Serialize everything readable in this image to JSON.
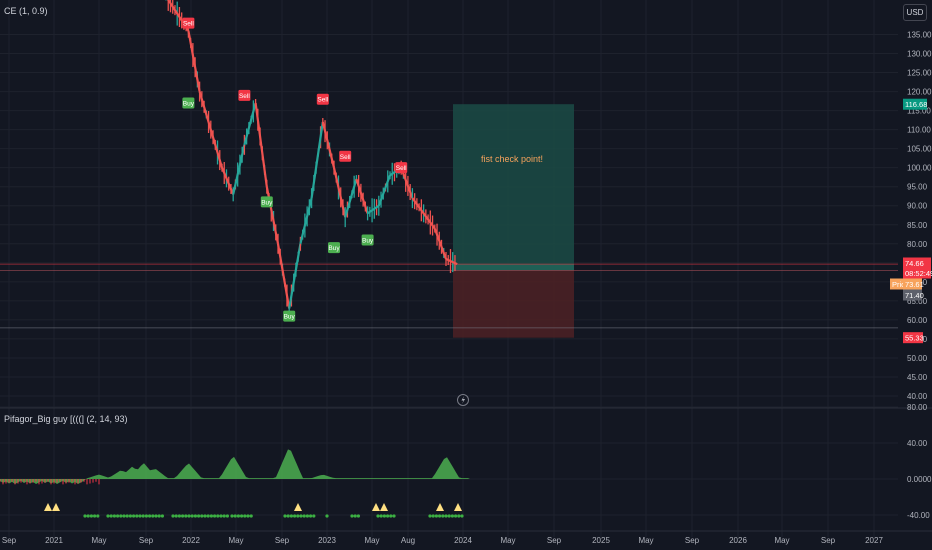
{
  "symbol_legend": "CE (1, 0.9)",
  "indicator_legend": "Pifagor_Big guy [(((] (2, 14, 93)",
  "currency": "USD",
  "annotation": "fist check point!",
  "colors": {
    "background": "#131722",
    "up": "#26a69a",
    "down": "#ef5350",
    "buy": "#4caf50",
    "sell": "#f23645",
    "target_zone": "#1b4b45",
    "stop_zone": "#4a2025",
    "annotation": "#f7a35c"
  },
  "chart_data": [
    {
      "type": "line",
      "title": "",
      "y_axis_ticks": [
        "40.00",
        "45.00",
        "50.00",
        "55.00",
        "60.00",
        "65.00",
        "70.00",
        "75.00",
        "80.00",
        "85.00",
        "90.00",
        "95.00",
        "100.00",
        "105.00",
        "110.00",
        "115.00",
        "120.00",
        "125.00",
        "130.00",
        "135.00"
      ],
      "ylim": [
        38,
        145
      ],
      "x_axis_ticks": [
        "Sep",
        "2021",
        "May",
        "Sep",
        "2022",
        "May",
        "Sep",
        "2023",
        "May",
        "Aug",
        "2024",
        "May",
        "Sep",
        "2025",
        "May",
        "Sep",
        "2026",
        "May",
        "Sep",
        "2027"
      ],
      "price_path": [
        {
          "x": "2021-11",
          "y": 145
        },
        {
          "x": "2022-01",
          "y": 136
        },
        {
          "x": "2022-02",
          "y": 120
        },
        {
          "x": "2022-04",
          "y": 100
        },
        {
          "x": "2022-05",
          "y": 93
        },
        {
          "x": "2022-06",
          "y": 106
        },
        {
          "x": "2022-07",
          "y": 117
        },
        {
          "x": "2022-08",
          "y": 95
        },
        {
          "x": "2022-09",
          "y": 80
        },
        {
          "x": "2022-10",
          "y": 63
        },
        {
          "x": "2022-11",
          "y": 80
        },
        {
          "x": "2022-12",
          "y": 92
        },
        {
          "x": "2023-01",
          "y": 112
        },
        {
          "x": "2023-02",
          "y": 100
        },
        {
          "x": "2023-03",
          "y": 87
        },
        {
          "x": "2023-04",
          "y": 97
        },
        {
          "x": "2023-05",
          "y": 88
        },
        {
          "x": "2023-06",
          "y": 90
        },
        {
          "x": "2023-07",
          "y": 98
        },
        {
          "x": "2023-08",
          "y": 100
        },
        {
          "x": "2023-09",
          "y": 92
        },
        {
          "x": "2023-11",
          "y": 84
        },
        {
          "x": "2023-12",
          "y": 76
        },
        {
          "x": "2024-01",
          "y": 74.66
        }
      ],
      "signals": [
        {
          "label": "Sell",
          "date": "2022-01",
          "price": 138
        },
        {
          "label": "Buy",
          "date": "2022-01",
          "price": 117
        },
        {
          "label": "Sell",
          "date": "2022-06",
          "price": 119
        },
        {
          "label": "Buy",
          "date": "2022-08",
          "price": 91
        },
        {
          "label": "Buy",
          "date": "2022-10",
          "price": 61
        },
        {
          "label": "Sell",
          "date": "2023-01",
          "price": 118
        },
        {
          "label": "Buy",
          "date": "2023-02",
          "price": 79
        },
        {
          "label": "Sell",
          "date": "2023-03",
          "price": 103
        },
        {
          "label": "Buy",
          "date": "2023-05",
          "price": 81
        },
        {
          "label": "Sell",
          "date": "2023-08",
          "price": 100
        }
      ],
      "horizontal_lines": [
        74.66,
        73.61,
        57.9
      ],
      "position_tool": {
        "target": 116.68,
        "entry": 73.61,
        "stop": 55.33
      },
      "price_labels": [
        {
          "text": "116.68",
          "value": 116.68,
          "color": "#089981"
        },
        {
          "text": "74.66",
          "value": 74.66,
          "color": "#f23645"
        },
        {
          "text": "08:52:49",
          "value": 73.7,
          "color": "#f23645"
        },
        {
          "text": "Pric",
          "value": 73.0,
          "color": "#f7a35c"
        },
        {
          "text": "73.61",
          "value": 73.0,
          "color": "#f7a35c"
        },
        {
          "text": "71.40",
          "value": 71.0,
          "color": "#5d606b"
        },
        {
          "text": "55.33",
          "value": 55.33,
          "color": "#f23645"
        }
      ]
    },
    {
      "type": "area",
      "title": "Pifagor_Big guy [(((] (2, 14, 93)",
      "y_axis_ticks": [
        "80.00",
        "40.00",
        "0.0000",
        "-40.00"
      ],
      "ylim": [
        -60,
        100
      ],
      "peaks": [
        {
          "x": "2021-05",
          "y": 5
        },
        {
          "x": "2021-07",
          "y": 10
        },
        {
          "x": "2021-08",
          "y": 14
        },
        {
          "x": "2021-09",
          "y": 18
        },
        {
          "x": "2021-10",
          "y": 12
        },
        {
          "x": "2022-01",
          "y": 18
        },
        {
          "x": "2022-05",
          "y": 26
        },
        {
          "x": "2022-10",
          "y": 36
        },
        {
          "x": "2023-01",
          "y": 5
        },
        {
          "x": "2023-12",
          "y": 26
        }
      ]
    }
  ]
}
